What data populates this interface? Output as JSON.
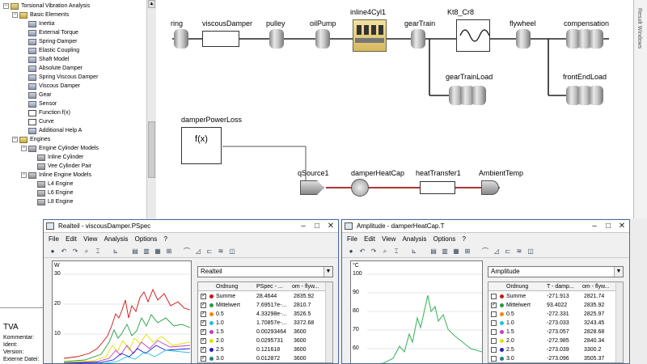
{
  "tree": {
    "items": [
      {
        "label": "Torsional Vibration Analysis",
        "depth": 0,
        "expander": "−",
        "icon": "folder"
      },
      {
        "label": "Basic Elements",
        "depth": 1,
        "expander": "−",
        "icon": "folder"
      },
      {
        "label": "Inertia",
        "depth": 2,
        "expander": "",
        "icon": "component"
      },
      {
        "label": "External Torque",
        "depth": 2,
        "expander": "",
        "icon": "component"
      },
      {
        "label": "Spring-Damper",
        "depth": 2,
        "expander": "",
        "icon": "component"
      },
      {
        "label": "Elastic Coupling",
        "depth": 2,
        "expander": "",
        "icon": "component"
      },
      {
        "label": "Shaft Model",
        "depth": 2,
        "expander": "",
        "icon": "component"
      },
      {
        "label": "Absolute Damper",
        "depth": 2,
        "expander": "",
        "icon": "component"
      },
      {
        "label": "Spring Viscous Damper",
        "depth": 2,
        "expander": "",
        "icon": "component"
      },
      {
        "label": "Viscous Damper",
        "depth": 2,
        "expander": "",
        "icon": "component"
      },
      {
        "label": "Gear",
        "depth": 2,
        "expander": "",
        "icon": "component"
      },
      {
        "label": "Sensor",
        "depth": 2,
        "expander": "",
        "icon": "component"
      },
      {
        "label": "Function f(x)",
        "depth": 2,
        "expander": "",
        "icon": "fx"
      },
      {
        "label": "Curve",
        "depth": 2,
        "expander": "",
        "icon": "fx"
      },
      {
        "label": "Additional Help A",
        "depth": 2,
        "expander": "",
        "icon": "component"
      },
      {
        "label": "Engines",
        "depth": 1,
        "expander": "−",
        "icon": "folder"
      },
      {
        "label": "Engine Cylinder Models",
        "depth": 2,
        "expander": "−",
        "icon": "engine"
      },
      {
        "label": "Inline Cylinder",
        "depth": 3,
        "expander": "",
        "icon": "engine"
      },
      {
        "label": "Vee Cylinder Pair",
        "depth": 3,
        "expander": "",
        "icon": "engine"
      },
      {
        "label": "Inline Engine Models",
        "depth": 2,
        "expander": "−",
        "icon": "engine"
      },
      {
        "label": "L4 Engine",
        "depth": 3,
        "expander": "",
        "icon": "engine"
      },
      {
        "label": "L6 Engine",
        "depth": 3,
        "expander": "",
        "icon": "engine"
      },
      {
        "label": "L8 Engine",
        "depth": 3,
        "expander": "",
        "icon": "engine"
      }
    ]
  },
  "props": {
    "title": "TVA",
    "rows": [
      "Kommentar:",
      "Ident:",
      "Version:",
      "Externe Datei:"
    ]
  },
  "diagram": {
    "labels": {
      "ring": "ring",
      "viscousDamper": "viscousDamper",
      "pulley": "pulley",
      "oilPump": "oilPump",
      "inline4Cyl1": "inline4Cyl1",
      "gearTrain": "gearTrain",
      "kt8": "Kt8_Cr8",
      "flywheel": "flywheel",
      "compensation": "compensation",
      "gearTrainLoad": "gearTrainLoad",
      "frontEndLoad": "frontEndLoad",
      "damperPowerLoss": "damperPowerLoss",
      "fx": "f(x)",
      "qSource1": "qSource1",
      "damperHeatCap": "damperHeatCap",
      "heatTransfer1": "heatTransfer1",
      "ambientTemp": "AmbientTemp"
    },
    "sidebar_text": "Result Windows"
  },
  "colors": {
    "mech_line": "#222222",
    "thermal_line": "#a01818",
    "window_border": "#4a6a9a"
  },
  "win1": {
    "title": "Realteil - viscousDamper.PSpec",
    "menus": [
      "File",
      "Edit",
      "View",
      "Analysis",
      "Options",
      "?"
    ],
    "y_unit": "W",
    "y_ticks": [
      "30",
      "20",
      "10",
      "0"
    ],
    "select_value": "Realteil",
    "columns": [
      "Ordnung",
      "PSpec - ...",
      "om - flyw..."
    ],
    "rows": [
      {
        "checked": true,
        "color": "#d01010",
        "ord": "Summe",
        "v1": "28.4644",
        "v2": "2835.92"
      },
      {
        "checked": true,
        "color": "#20a040",
        "ord": "Mittelwert",
        "v1": "7.69517e-...",
        "v2": "2810.7"
      },
      {
        "checked": true,
        "color": "#ff8000",
        "ord": "0.5",
        "v1": "4.33298e-...",
        "v2": "3526.5"
      },
      {
        "checked": true,
        "color": "#20c0e0",
        "ord": "1.0",
        "v1": "1.70857e-...",
        "v2": "3372.68"
      },
      {
        "checked": true,
        "color": "#c040c0",
        "ord": "1.5",
        "v1": "0.00293464",
        "v2": "3600"
      },
      {
        "checked": true,
        "color": "#e0e000",
        "ord": "2.0",
        "v1": "0.0295731",
        "v2": "3600"
      },
      {
        "checked": true,
        "color": "#2020c0",
        "ord": "2.5",
        "v1": "0.121618",
        "v2": "3600"
      },
      {
        "checked": true,
        "color": "#208080",
        "ord": "3.0",
        "v1": "0.012872",
        "v2": "3600"
      }
    ]
  },
  "win2": {
    "title": "Amplitude - damperHeatCap.T",
    "menus": [
      "File",
      "Edit",
      "View",
      "Analysis",
      "Options",
      "?"
    ],
    "y_unit": "°C",
    "y_ticks": [
      "100",
      "90",
      "80",
      "70",
      "60",
      "50"
    ],
    "select_value": "Amplitude",
    "columns": [
      "Ordnung",
      "T - damp...",
      "om - flyw..."
    ],
    "rows": [
      {
        "checked": false,
        "color": "#d01010",
        "ord": "Summe",
        "v1": "-271.913",
        "v2": "2821.74"
      },
      {
        "checked": true,
        "color": "#20a040",
        "ord": "Mittelwert",
        "v1": "93.4022",
        "v2": "2835.92"
      },
      {
        "checked": false,
        "color": "#ff8000",
        "ord": "0.5",
        "v1": "-272.331",
        "v2": "2825.97"
      },
      {
        "checked": false,
        "color": "#20c0e0",
        "ord": "1.0",
        "v1": "-273.033",
        "v2": "3243.45"
      },
      {
        "checked": false,
        "color": "#c040c0",
        "ord": "1.5",
        "v1": "-273.057",
        "v2": "2828.68"
      },
      {
        "checked": false,
        "color": "#e0e000",
        "ord": "2.0",
        "v1": "-272.985",
        "v2": "2840.34"
      },
      {
        "checked": false,
        "color": "#2020c0",
        "ord": "2.5",
        "v1": "-273.039",
        "v2": "3300.2"
      },
      {
        "checked": false,
        "color": "#208080",
        "ord": "3.0",
        "v1": "-273.096",
        "v2": "3505.37"
      }
    ]
  }
}
